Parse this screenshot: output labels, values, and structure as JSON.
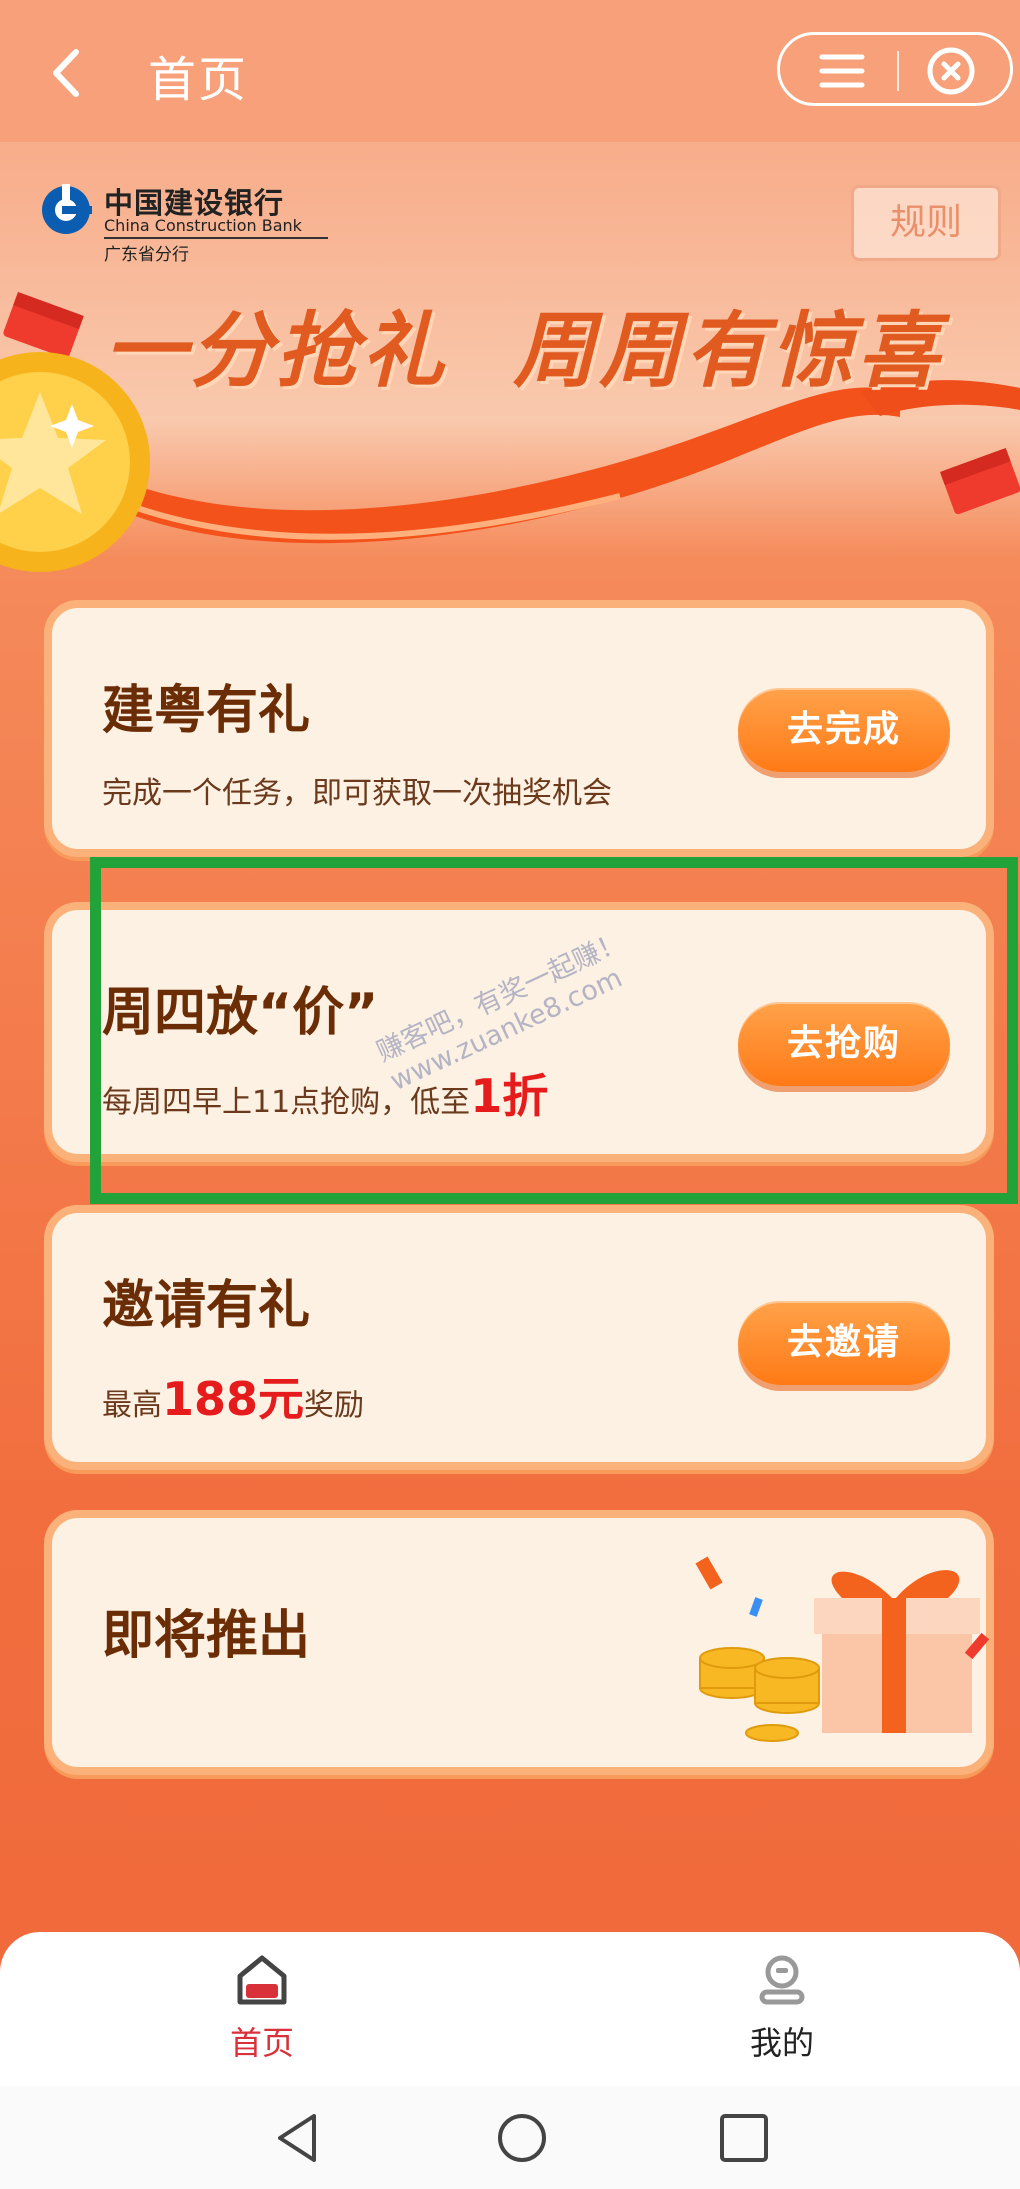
{
  "nav": {
    "title": "首页"
  },
  "banner": {
    "bank_name_cn": "中国建设银行",
    "bank_name_en": "China Construction Bank",
    "branch": "广东省分行",
    "rules_label": "规则",
    "headline": "一分抢礼  周周有惊喜"
  },
  "cards": [
    {
      "title": "建粤有礼",
      "desc": "完成一个任务，即可获取一次抽奖机会",
      "button": "去完成"
    },
    {
      "title": "周四放“价”",
      "desc_prefix": "每周四早上11点抢购，低至",
      "desc_highlight": "1折",
      "button": "去抢购"
    },
    {
      "title": "邀请有礼",
      "desc_prefix": "最高",
      "desc_highlight": "188元",
      "desc_suffix": "奖励",
      "button": "去邀请"
    },
    {
      "title": "即将推出"
    }
  ],
  "watermark": "赚客吧，有奖一起赚！\nwww.zuanke8.com",
  "tabbar": [
    {
      "label": "首页",
      "active": true
    },
    {
      "label": "我的",
      "active": false
    }
  ],
  "colors": {
    "accent": "#ff7a16",
    "title_brown": "#6b2d05",
    "highlight_red": "#e61c1c",
    "active_tab": "#d8313a",
    "annotation_green": "#21a339"
  }
}
